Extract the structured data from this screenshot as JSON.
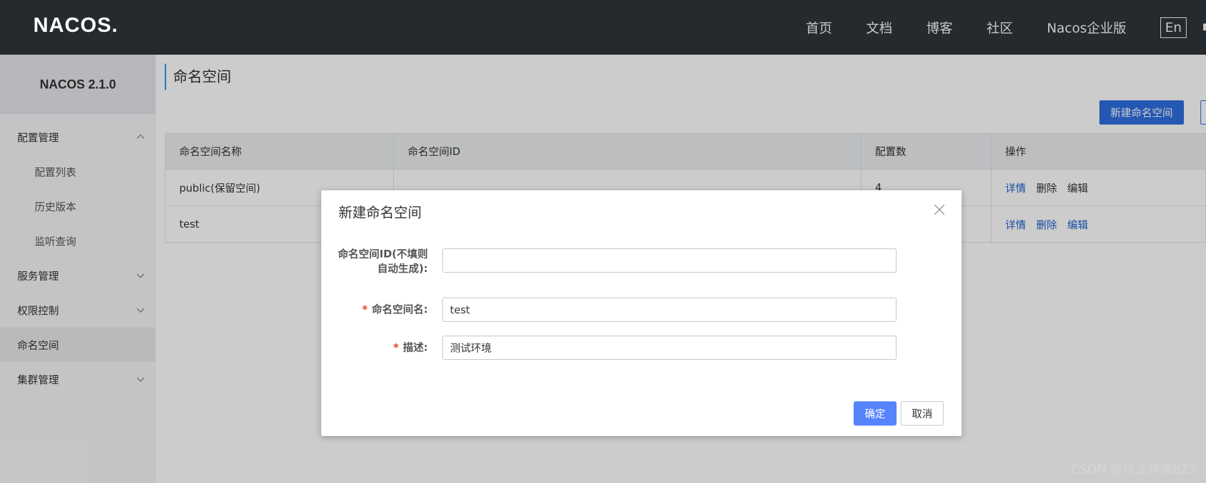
{
  "header": {
    "logo": "NACOS.",
    "nav": [
      "首页",
      "文档",
      "博客",
      "社区",
      "Nacos企业版"
    ],
    "lang": "En"
  },
  "sidebar": {
    "version": "NACOS 2.1.0",
    "items": [
      {
        "label": "配置管理",
        "expanded": true
      },
      {
        "label": "配置列表",
        "sub": true
      },
      {
        "label": "历史版本",
        "sub": true
      },
      {
        "label": "监听查询",
        "sub": true
      },
      {
        "label": "服务管理",
        "expanded": false
      },
      {
        "label": "权限控制",
        "expanded": false
      },
      {
        "label": "命名空间",
        "active": true
      },
      {
        "label": "集群管理",
        "expanded": false
      }
    ]
  },
  "main": {
    "title": "命名空间",
    "new_button": "新建命名空间",
    "table": {
      "headers": [
        "命名空间名称",
        "命名空间ID",
        "配置数",
        "操作"
      ],
      "rows": [
        {
          "name": "public(保留空间)",
          "id": "",
          "count": "4",
          "ops": [
            "详情",
            "删除",
            "编辑"
          ]
        },
        {
          "name": "test",
          "id": "",
          "count": "",
          "ops": [
            "详情",
            "删除",
            "编辑"
          ]
        }
      ]
    }
  },
  "dialog": {
    "title": "新建命名空间",
    "fields": {
      "ns_id_label_1": "命名空间ID(不填则",
      "ns_id_label_2": "自动生成):",
      "ns_id_value": "",
      "ns_name_label": "命名空间名:",
      "ns_name_value": "test",
      "desc_label": "描述:",
      "desc_value": "测试环境",
      "required_mark": "*"
    },
    "ok": "确定",
    "cancel": "取消"
  },
  "watermark": "CSDN @风之神樂823",
  "colors": {
    "topbar": "#252a2f",
    "primary": "#5584ff",
    "link": "#1f5fd0",
    "required": "#e63d12"
  }
}
